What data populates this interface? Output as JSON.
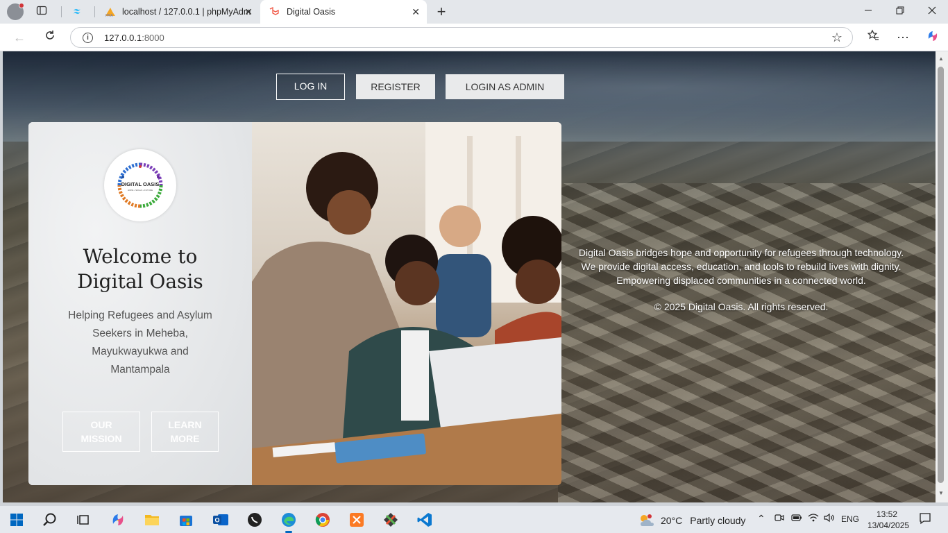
{
  "browser": {
    "tabs": [
      {
        "label": "",
        "favicon": "tailwind-icon"
      },
      {
        "label": "localhost / 127.0.0.1 | phpMyAdm",
        "favicon": "phpmyadmin-icon"
      },
      {
        "label": "Digital Oasis",
        "favicon": "laravel-icon",
        "active": true
      }
    ],
    "address": {
      "host": "127.0.0.1",
      "port": ":8000"
    }
  },
  "page": {
    "nav": {
      "login": "LOG IN",
      "register": "REGISTER",
      "admin": "LOGIN AS ADMIN"
    },
    "card": {
      "logo_text": "DIGITAL OASIS",
      "logo_tagline": "HOPE • SKILLS • FUTURE",
      "title_line1": "Welcome to",
      "title_line2": "Digital Oasis",
      "subtitle_line1": "Helping Refugees and Asylum",
      "subtitle_line2": "Seekers in Meheba,",
      "subtitle_line3": "Mayukwayukwa and",
      "subtitle_line4": "Mantampala",
      "mission_line1": "OUR",
      "mission_line2": "MISSION",
      "learn_line1": "LEARN",
      "learn_line2": "MORE"
    },
    "blurb": {
      "line1": "Digital Oasis bridges hope and opportunity for refugees through technology.",
      "line2": "We provide digital access, education, and tools to rebuild lives with dignity.",
      "line3": "Empowering displaced communities in a connected world."
    },
    "copyright": "© 2025 Digital Oasis. All rights reserved."
  },
  "taskbar": {
    "weather": {
      "temp": "20°C",
      "desc": "Partly cloudy"
    },
    "lang": "ENG",
    "time": "13:52",
    "date": "13/04/2025"
  },
  "colors": {
    "accent": "#0067c0",
    "tab_active": "#ffffff",
    "nav_light_btn": "#e9eaeb"
  }
}
